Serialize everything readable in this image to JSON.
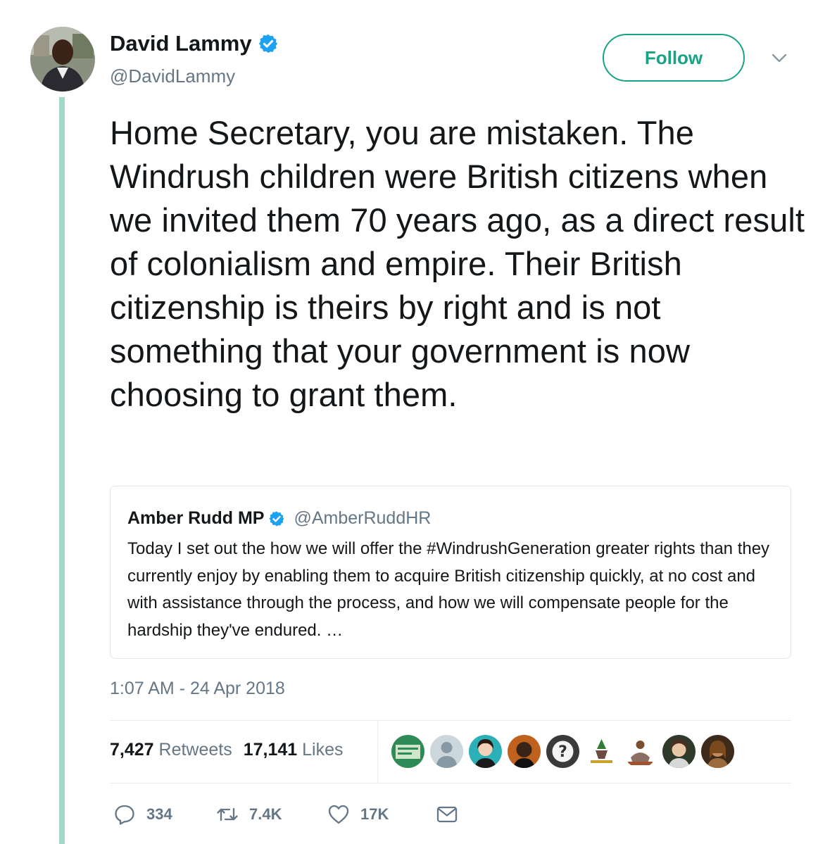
{
  "author": {
    "name": "David Lammy",
    "handle": "@DavidLammy",
    "avatar_icon": "profile-photo",
    "verified_icon": "verified-badge-icon"
  },
  "follow_button": {
    "label": "Follow"
  },
  "menu_icon": "chevron-down-icon",
  "tweet": {
    "text": "Home Secretary, you are mistaken. The Windrush children were British citizens when we invited them 70 years ago, as a direct result of colonialism and empire. Their British citizenship is theirs by right and is not something that your government is now choosing to grant them."
  },
  "quoted_tweet": {
    "name": "Amber Rudd MP",
    "handle": "@AmberRuddHR",
    "text": "Today I set out the how we will offer the #WindrushGeneration greater rights than they currently enjoy by enabling them to acquire British citizenship quickly, at no cost and with assistance through the process, and how we will compensate people for the hardship they've endured. …"
  },
  "timestamp": "1:07 AM - 24 Apr 2018",
  "stats": {
    "retweets_count": "7,427",
    "retweets_label": "Retweets",
    "likes_count": "17,141",
    "likes_label": "Likes"
  },
  "actions": {
    "reply_count": "334",
    "retweet_count": "7.4K",
    "like_count": "17K"
  },
  "colors": {
    "accent": "#17a385",
    "thread_line": "#a1d8c8",
    "verified": "#1da1f2",
    "secondary_text": "#657786"
  }
}
